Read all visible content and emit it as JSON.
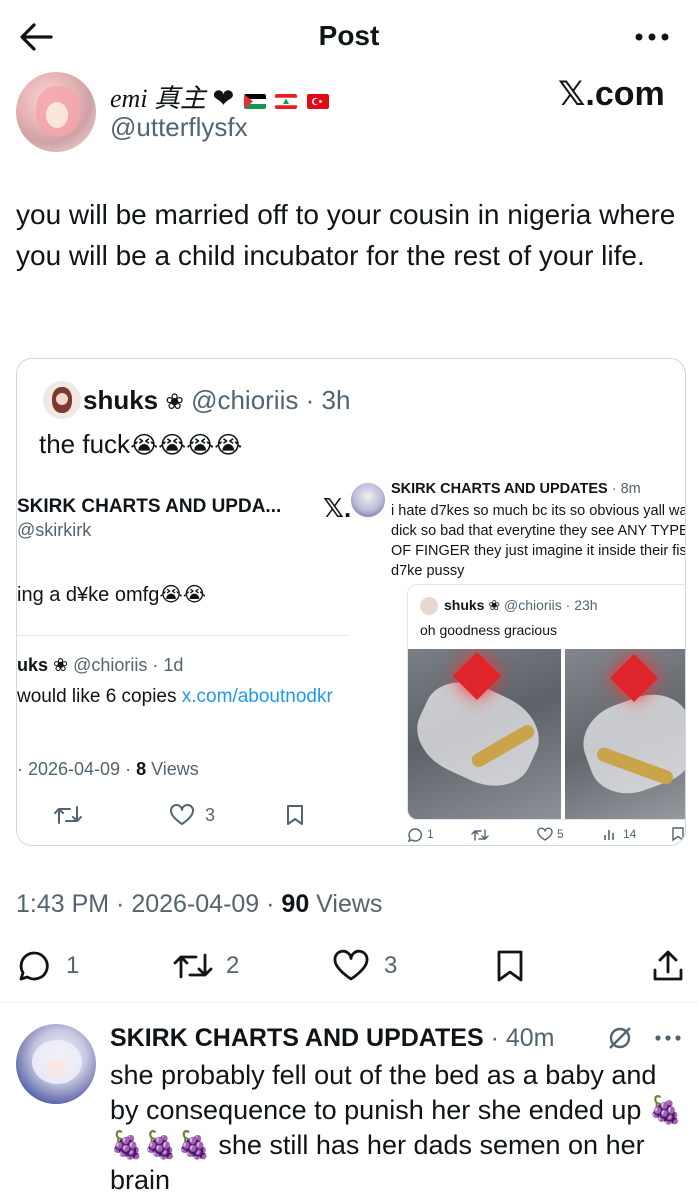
{
  "header": {
    "title": "Post"
  },
  "watermark": "𝕏.com",
  "author": {
    "name": "emi 真主",
    "heart": "❤",
    "handle": "@utterflysfx"
  },
  "post": {
    "text": "you will be married off to your cousin in nigeria where you will be a child incubator for the rest of your life.",
    "timestamp": "1:43 PM · 2026-04-09 · ",
    "views_count": "90",
    "views_label": " Views",
    "actions": {
      "replies": "1",
      "reposts": "2",
      "likes": "3"
    }
  },
  "quote": {
    "name": "shuks",
    "flower": "❀",
    "handle": "@chioriis",
    "time": "· 3h",
    "text": "the fuck",
    "emojis": "😭😭😭😭",
    "left_shot": {
      "name": "SKIRK CHARTS AND UPDA...",
      "handle": "@skirkirk",
      "x_logo": "𝕏.",
      "text": "ing a d¥ke omfg",
      "emoji": "😭😭",
      "reply_name": "uks ❀",
      "reply_handle": "@chioriis · 1d",
      "reply_text": "would like 6 copies ",
      "reply_link": "x.com/aboutnodkr",
      "meta_date": "· 2026-04-09 · ",
      "meta_views": "8",
      "meta_views_label": " Views",
      "likes": "3"
    },
    "right_shot": {
      "name": "SKIRK CHARTS AND UPDATES",
      "time": "· 8m",
      "text_lines": [
        "i hate d7kes so much bc its so obvious yall wa",
        "dick so bad that everytine they see ANY TYPE",
        "OF FINGER they just imagine it inside their fis",
        "d7ke pussy"
      ],
      "inner_name": "shuks ❀",
      "inner_handle": "@chioriis · 23h",
      "inner_text": "oh goodness gracious",
      "replies": "1",
      "likes": "5",
      "views": "14"
    }
  },
  "reply": {
    "name": "SKIRK CHARTS AND UPDATES",
    "time": "· 40m",
    "lines": [
      "she probably fell out of the bed as a baby and",
      "by consequence to punish her she ended up 🍇",
      "🍇🍇🍇 she still has her dads semen on her",
      "brain"
    ]
  },
  "icons": [
    "back-arrow-icon",
    "more-icon",
    "reply-icon",
    "repost-icon",
    "like-icon",
    "bookmark-icon",
    "share-icon",
    "grok-icon"
  ]
}
